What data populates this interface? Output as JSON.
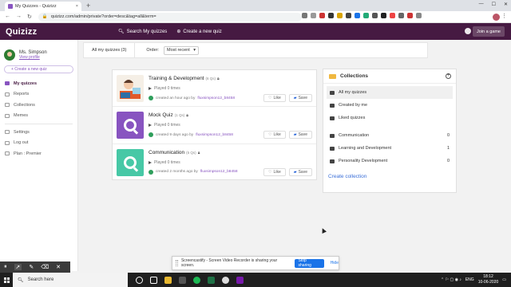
{
  "browser": {
    "tab_title": "My Quizzes - Quizizz",
    "tab_close": "×",
    "new_tab": "+",
    "url": "quizizz.com/admin/private?order=desc&tag=all&term=",
    "window_controls": [
      "—",
      "☐",
      "✕"
    ]
  },
  "header": {
    "logo": "Quizizz",
    "search_label": "Search My quizzes",
    "create_label": "Create a new quiz",
    "join_label": "Join a game"
  },
  "sidebar": {
    "user_name": "Ms. Simpson",
    "user_sub": "View profile",
    "create_quiz_label": "+ Create a new quiz",
    "items_top": [
      {
        "label": "My quizzes"
      },
      {
        "label": "Reports"
      },
      {
        "label": "Collections"
      },
      {
        "label": "Memes"
      }
    ],
    "items_bottom": [
      {
        "label": "Settings"
      },
      {
        "label": "Log out"
      },
      {
        "label": "Plan : Premier"
      }
    ]
  },
  "filter": {
    "tab_label": "All my quizzes (3)",
    "order_label": "Order:",
    "order_value": "Most recent"
  },
  "quizzes": [
    {
      "title": "Training & Development",
      "qs": "(6 Qs)",
      "played": "Played 0 times",
      "created": "created an hour ago by",
      "author": "fluxsimpson12_b8458",
      "like": "Like",
      "save": "Save"
    },
    {
      "title": "Mock Quiz",
      "qs": "(1 Qs)",
      "played": "Played 0 times",
      "created": "created 9 days ago by",
      "author": "fluxsimpson12_b8458",
      "like": "Like",
      "save": "Save"
    },
    {
      "title": "Communication",
      "qs": "(5 Qs)",
      "played": "Played 0 times",
      "created": "created 2 months ago by",
      "author": "fluxsimpson12_b8458",
      "like": "Like",
      "save": "Save"
    }
  ],
  "collections": {
    "title": "Collections",
    "items": [
      {
        "label": "All my quizzes"
      },
      {
        "label": "Created by me"
      },
      {
        "label": "Liked quizzes"
      }
    ],
    "user_collections": [
      {
        "label": "Communication",
        "count": "0"
      },
      {
        "label": "Learning and Development",
        "count": "1"
      },
      {
        "label": "Personality Development",
        "count": "0"
      }
    ],
    "create_label": "Create collection"
  },
  "share_bar": {
    "message": "Screencastify - Screen Video Recorder is sharing your screen.",
    "stop_label": "Stop sharing",
    "hide_label": "Hide"
  },
  "taskbar": {
    "search_placeholder": "Search here",
    "lang": "ENG",
    "time": "18:12",
    "date": "10-06-2020"
  },
  "colors": {
    "quizizz_purple": "#461a42",
    "accent": "#8854c0",
    "mock_quiz_thumb": "#8854c0",
    "communication_thumb": "#47c8a6",
    "stop_button": "#1a73e8"
  }
}
